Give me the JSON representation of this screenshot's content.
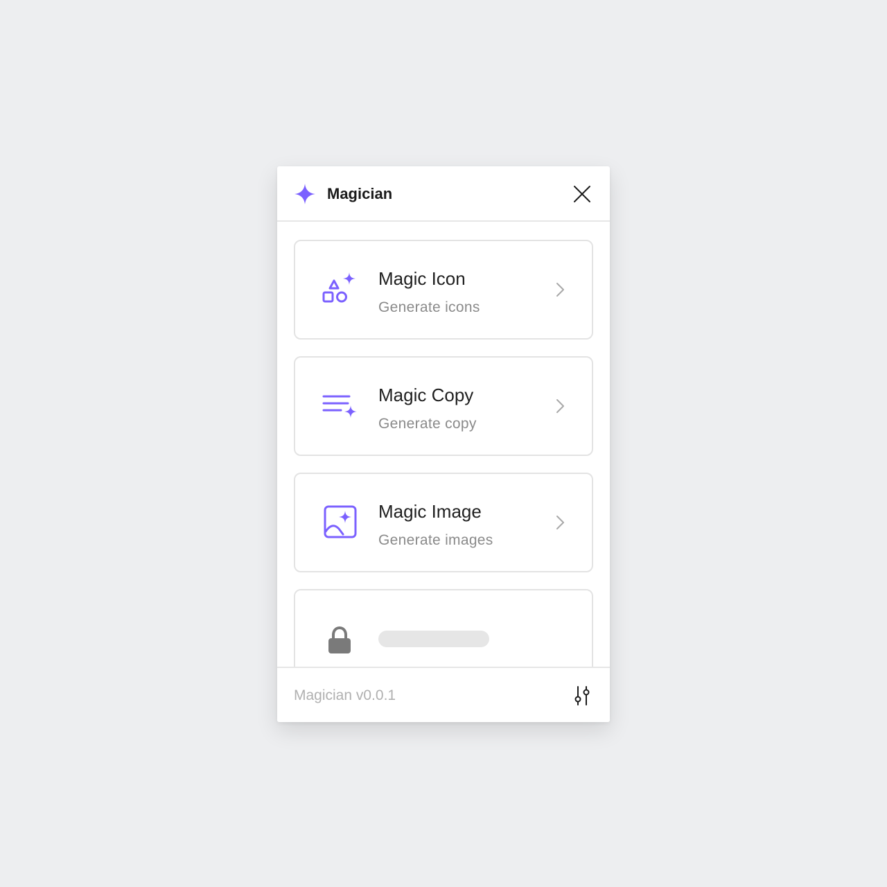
{
  "header": {
    "title": "Magician"
  },
  "tools": [
    {
      "name": "Magic Icon",
      "description": "Generate icons",
      "icon": "shapes-sparkle-icon"
    },
    {
      "name": "Magic Copy",
      "description": "Generate copy",
      "icon": "text-sparkle-icon"
    },
    {
      "name": "Magic Image",
      "description": "Generate images",
      "icon": "image-sparkle-icon"
    }
  ],
  "locked_item": {
    "icon": "lock-icon"
  },
  "footer": {
    "version": "Magician v0.0.1"
  },
  "colors": {
    "accent": "#7b61ff",
    "background": "#edeef0",
    "text": "#1f1f1f",
    "muted": "#8a8a8a"
  }
}
